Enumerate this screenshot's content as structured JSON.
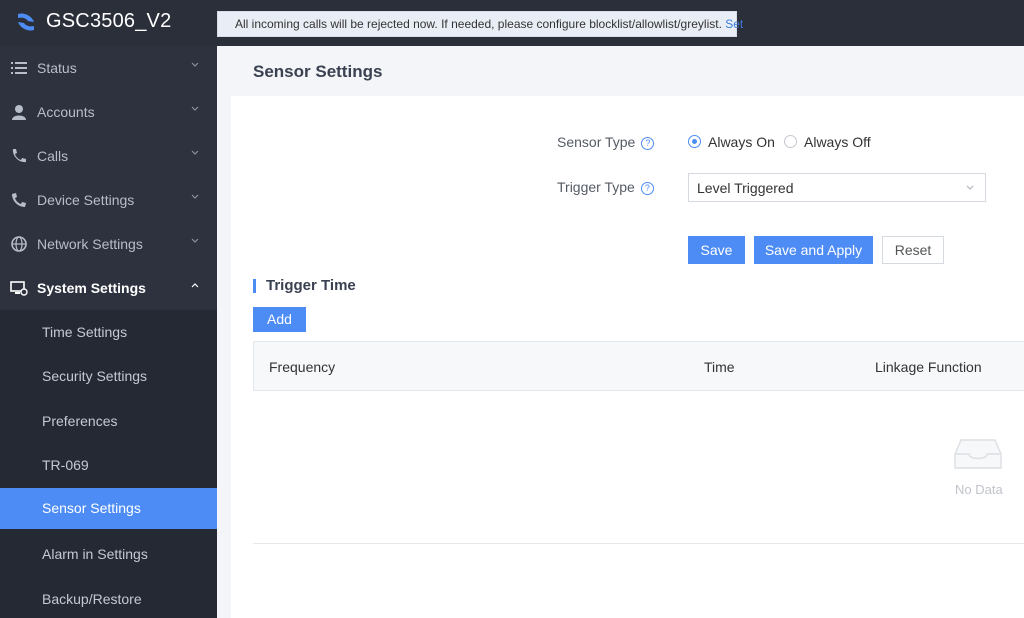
{
  "app": {
    "title": "GSC3506_V2"
  },
  "notice": {
    "text": "All incoming calls will be rejected now. If needed, please configure blocklist/allowlist/greylist.",
    "link": "Set"
  },
  "sidebar": {
    "items": [
      {
        "label": "Status",
        "icon": "list-icon"
      },
      {
        "label": "Accounts",
        "icon": "user-icon"
      },
      {
        "label": "Calls",
        "icon": "phone-icon"
      },
      {
        "label": "Device Settings",
        "icon": "handset-icon"
      },
      {
        "label": "Network Settings",
        "icon": "globe-icon"
      },
      {
        "label": "System Settings",
        "icon": "monitor-gear-icon",
        "expanded": true
      }
    ],
    "subitems": [
      {
        "label": "Time Settings"
      },
      {
        "label": "Security Settings"
      },
      {
        "label": "Preferences"
      },
      {
        "label": "TR-069"
      },
      {
        "label": "Sensor Settings",
        "active": true
      },
      {
        "label": "Alarm in Settings"
      },
      {
        "label": "Backup/Restore"
      }
    ]
  },
  "page": {
    "title": "Sensor Settings"
  },
  "form": {
    "sensor_type": {
      "label": "Sensor Type",
      "options": [
        "Always On",
        "Always Off"
      ],
      "selected": "Always On"
    },
    "trigger_type": {
      "label": "Trigger Type",
      "value": "Level Triggered"
    }
  },
  "buttons": {
    "save": "Save",
    "save_apply": "Save and Apply",
    "reset": "Reset",
    "add": "Add"
  },
  "trigger_time": {
    "title": "Trigger Time",
    "columns": [
      "Frequency",
      "Time",
      "Linkage Function"
    ],
    "rows": [],
    "empty_text": "No Data"
  },
  "colors": {
    "accent": "#4d8cf5",
    "sidebar": "#2d323e",
    "topbar": "#2b2f3a"
  }
}
